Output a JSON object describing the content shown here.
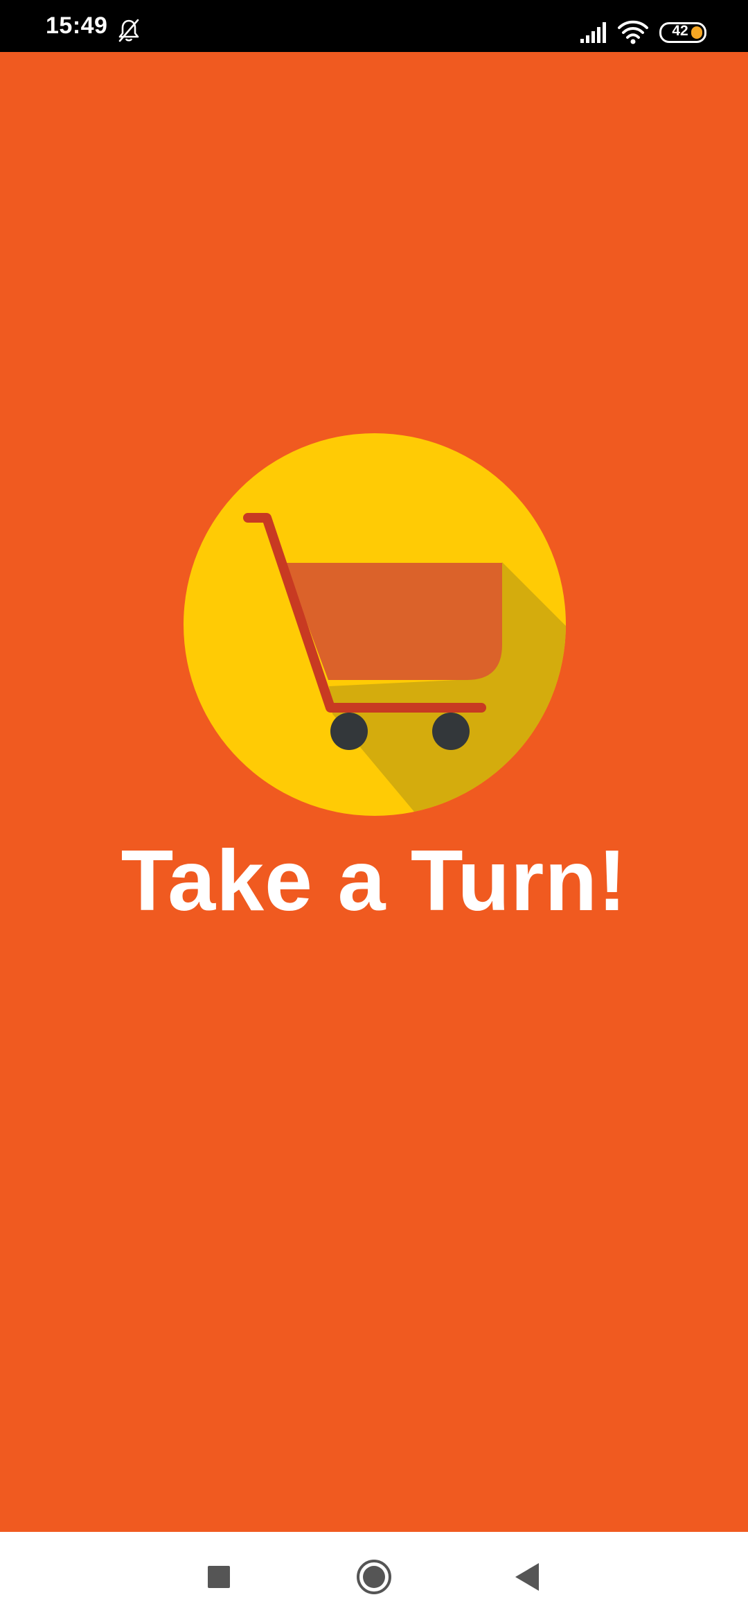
{
  "status_bar": {
    "time": "15:49",
    "battery_level": "42",
    "icons": [
      "bell-off-icon",
      "signal-icon",
      "wifi-icon",
      "battery-icon"
    ]
  },
  "splash": {
    "title": "Take a Turn!",
    "logo_icon": "shopping-cart-icon",
    "background_color": "#F05A20",
    "logo_circle_color": "#FFCB05"
  },
  "nav_bar": {
    "icons": [
      "recents-square-icon",
      "home-circle-icon",
      "back-triangle-icon"
    ]
  }
}
